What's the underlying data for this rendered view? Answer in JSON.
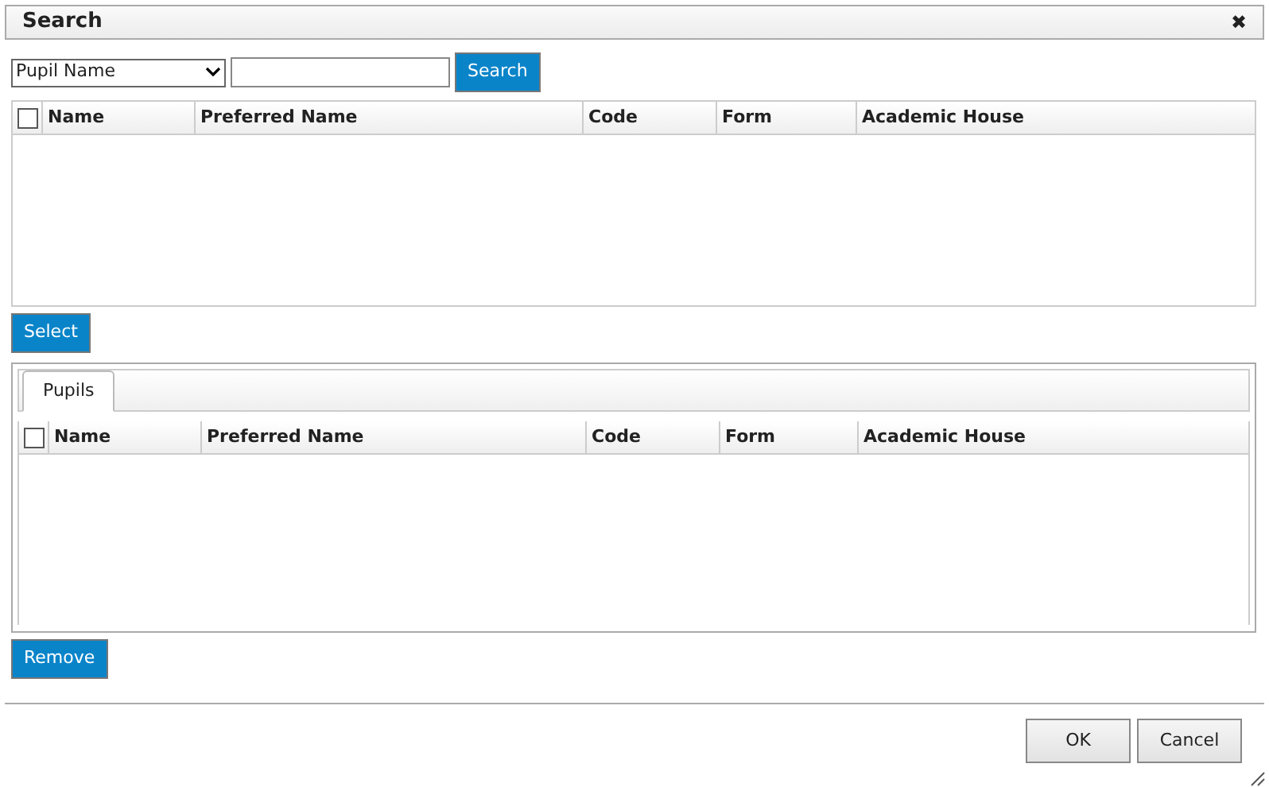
{
  "window": {
    "title": "Search",
    "close": "✖"
  },
  "search": {
    "field": "Pupil Name",
    "button": "Search"
  },
  "results_grid": {
    "select_all_checked": false,
    "columns": [
      "Name",
      "Preferred Name",
      "Code",
      "Form",
      "Academic House"
    ]
  },
  "select_button": "Select",
  "tabs": [
    {
      "label": "Pupils",
      "selected": true
    }
  ],
  "selected_grid": {
    "select_all_checked": false,
    "columns": [
      "Name",
      "Preferred Name",
      "Code",
      "Form",
      "Academic House"
    ]
  },
  "remove_button": "Remove",
  "buttons": [
    "OK",
    "Cancel"
  ]
}
